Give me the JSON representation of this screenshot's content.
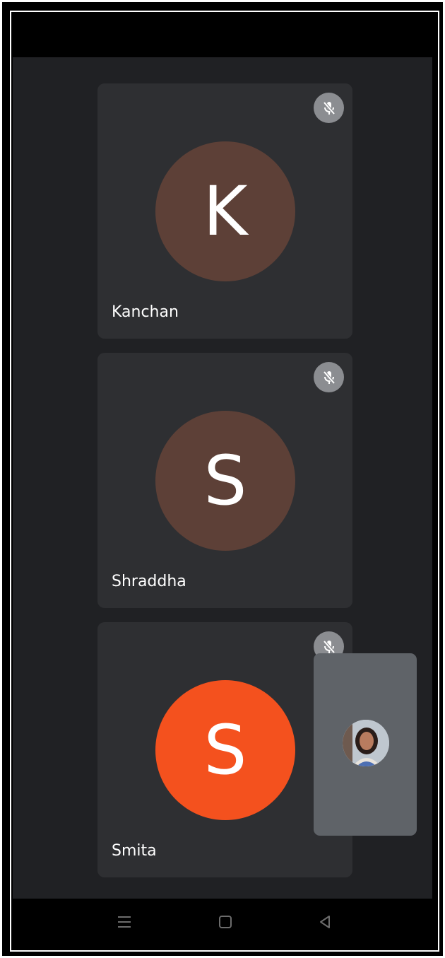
{
  "participants": [
    {
      "initial": "K",
      "name": "Kanchan",
      "avatar_color": "#5d4037",
      "muted": true
    },
    {
      "initial": "S",
      "name": "Shraddha",
      "avatar_color": "#5d4037",
      "muted": true
    },
    {
      "initial": "S",
      "name": "Smita",
      "avatar_color": "#f4511e",
      "muted": true
    }
  ],
  "icons": {
    "mic_muted": "mic-off-icon",
    "nav_recents": "menu-icon",
    "nav_home": "home-icon",
    "nav_back": "back-icon"
  },
  "colors": {
    "background": "#202124",
    "tile": "#2e2f32",
    "self_view": "#5f6368"
  }
}
